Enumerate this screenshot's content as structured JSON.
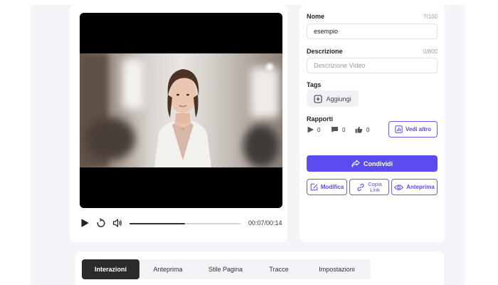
{
  "video": {
    "time_display": "00:07/00:14",
    "progress": 0.5
  },
  "form": {
    "name": {
      "label": "Nome",
      "value": "esempio",
      "counter": "7/100"
    },
    "description": {
      "label": "Descrizione",
      "value": "",
      "placeholder": "Descrizione Video",
      "counter": "0/800"
    },
    "tags": {
      "label": "Tags",
      "add_label": "Aggiungi"
    }
  },
  "reports": {
    "label": "Rapporti",
    "views": "0",
    "comments": "0",
    "likes": "0",
    "see_more_label": "Vedi altro"
  },
  "actions": {
    "share_label": "Condividi",
    "edit_label": "Modifica",
    "copy_link_line1": "Copia",
    "copy_link_line2": "Link",
    "preview_label": "Anteprima"
  },
  "tabs": [
    {
      "label": "Interazioni",
      "active": true
    },
    {
      "label": "Anteprima",
      "active": false
    },
    {
      "label": "Stile Pagina",
      "active": false
    },
    {
      "label": "Tracce",
      "active": false
    },
    {
      "label": "Impostazioni",
      "active": false
    }
  ],
  "icons": {
    "play": "play-icon",
    "replay": "replay-icon",
    "volume": "volume-icon",
    "add": "plus-box-icon",
    "views": "play-icon",
    "comments": "comment-icon",
    "likes": "thumbs-up-icon",
    "chart": "bar-chart-icon",
    "share": "share-icon",
    "edit": "edit-icon",
    "link": "link-icon",
    "eye": "eye-icon"
  },
  "colors": {
    "accent": "#5b4cf0",
    "active_tab": "#2b2b2b",
    "background": "#f4f5f8"
  }
}
